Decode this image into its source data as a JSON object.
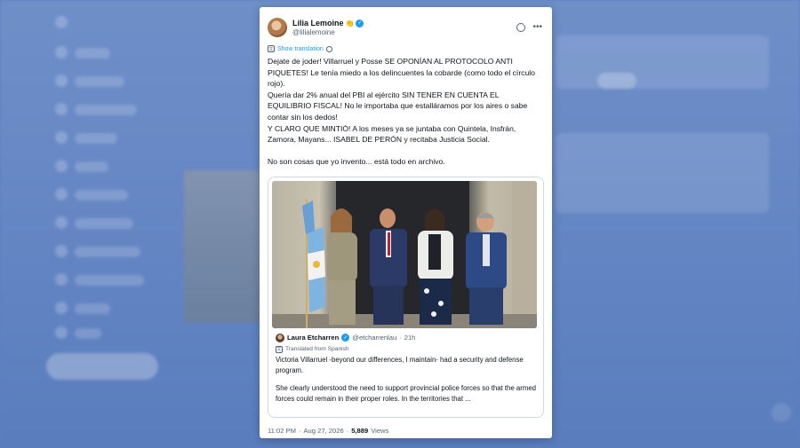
{
  "tweet": {
    "author_name": "Lilia Lemoine",
    "author_emoji": "👏",
    "author_handle": "@lilialemoine",
    "show_translation": "Show translation",
    "body_paragraphs": [
      "Dejate de joder! Villarruel y Posse SE OPONÍAN AL PROTOCOLO ANTI PIQUETES! Le tenía miedo a los delincuentes la cobarde (como todo el círculo rojo).",
      "Quería dar 2% anual del PBI al ejército SIN TENER EN CUENTA EL EQUILIBRIO FISCAL! No le importaba que estalláramos por los aires o sabe contar sin los dedos!",
      "Y CLARO QUE MINTIÓ! A los meses ya se juntaba con Quintela, Insfrán, Zamora, Mayans... ISABEL DE PERÓN y recitaba Justicia Social.",
      "No son cosas que yo invento... está todo en archivo."
    ],
    "quote": {
      "author_name": "Laura Etcharren",
      "author_handle": "@etcharrenlau",
      "time": "21h",
      "translated_label": "Translated from Spanish",
      "body_paragraphs": [
        "Victoria Villarruel -beyond our differences, I maintain- had a security and defense program.",
        "She clearly understood the need to support provincial police forces so that the armed forces could remain in their proper roles. In the territories that ..."
      ]
    },
    "time": "11:02 PM",
    "date": "Aug 27, 2026",
    "views_count": "5,889",
    "views_label": "Views"
  },
  "colors": {
    "background": "#5b7fc0",
    "accent": "#1d9bf0",
    "text": "#0f1419",
    "muted": "#536471"
  }
}
